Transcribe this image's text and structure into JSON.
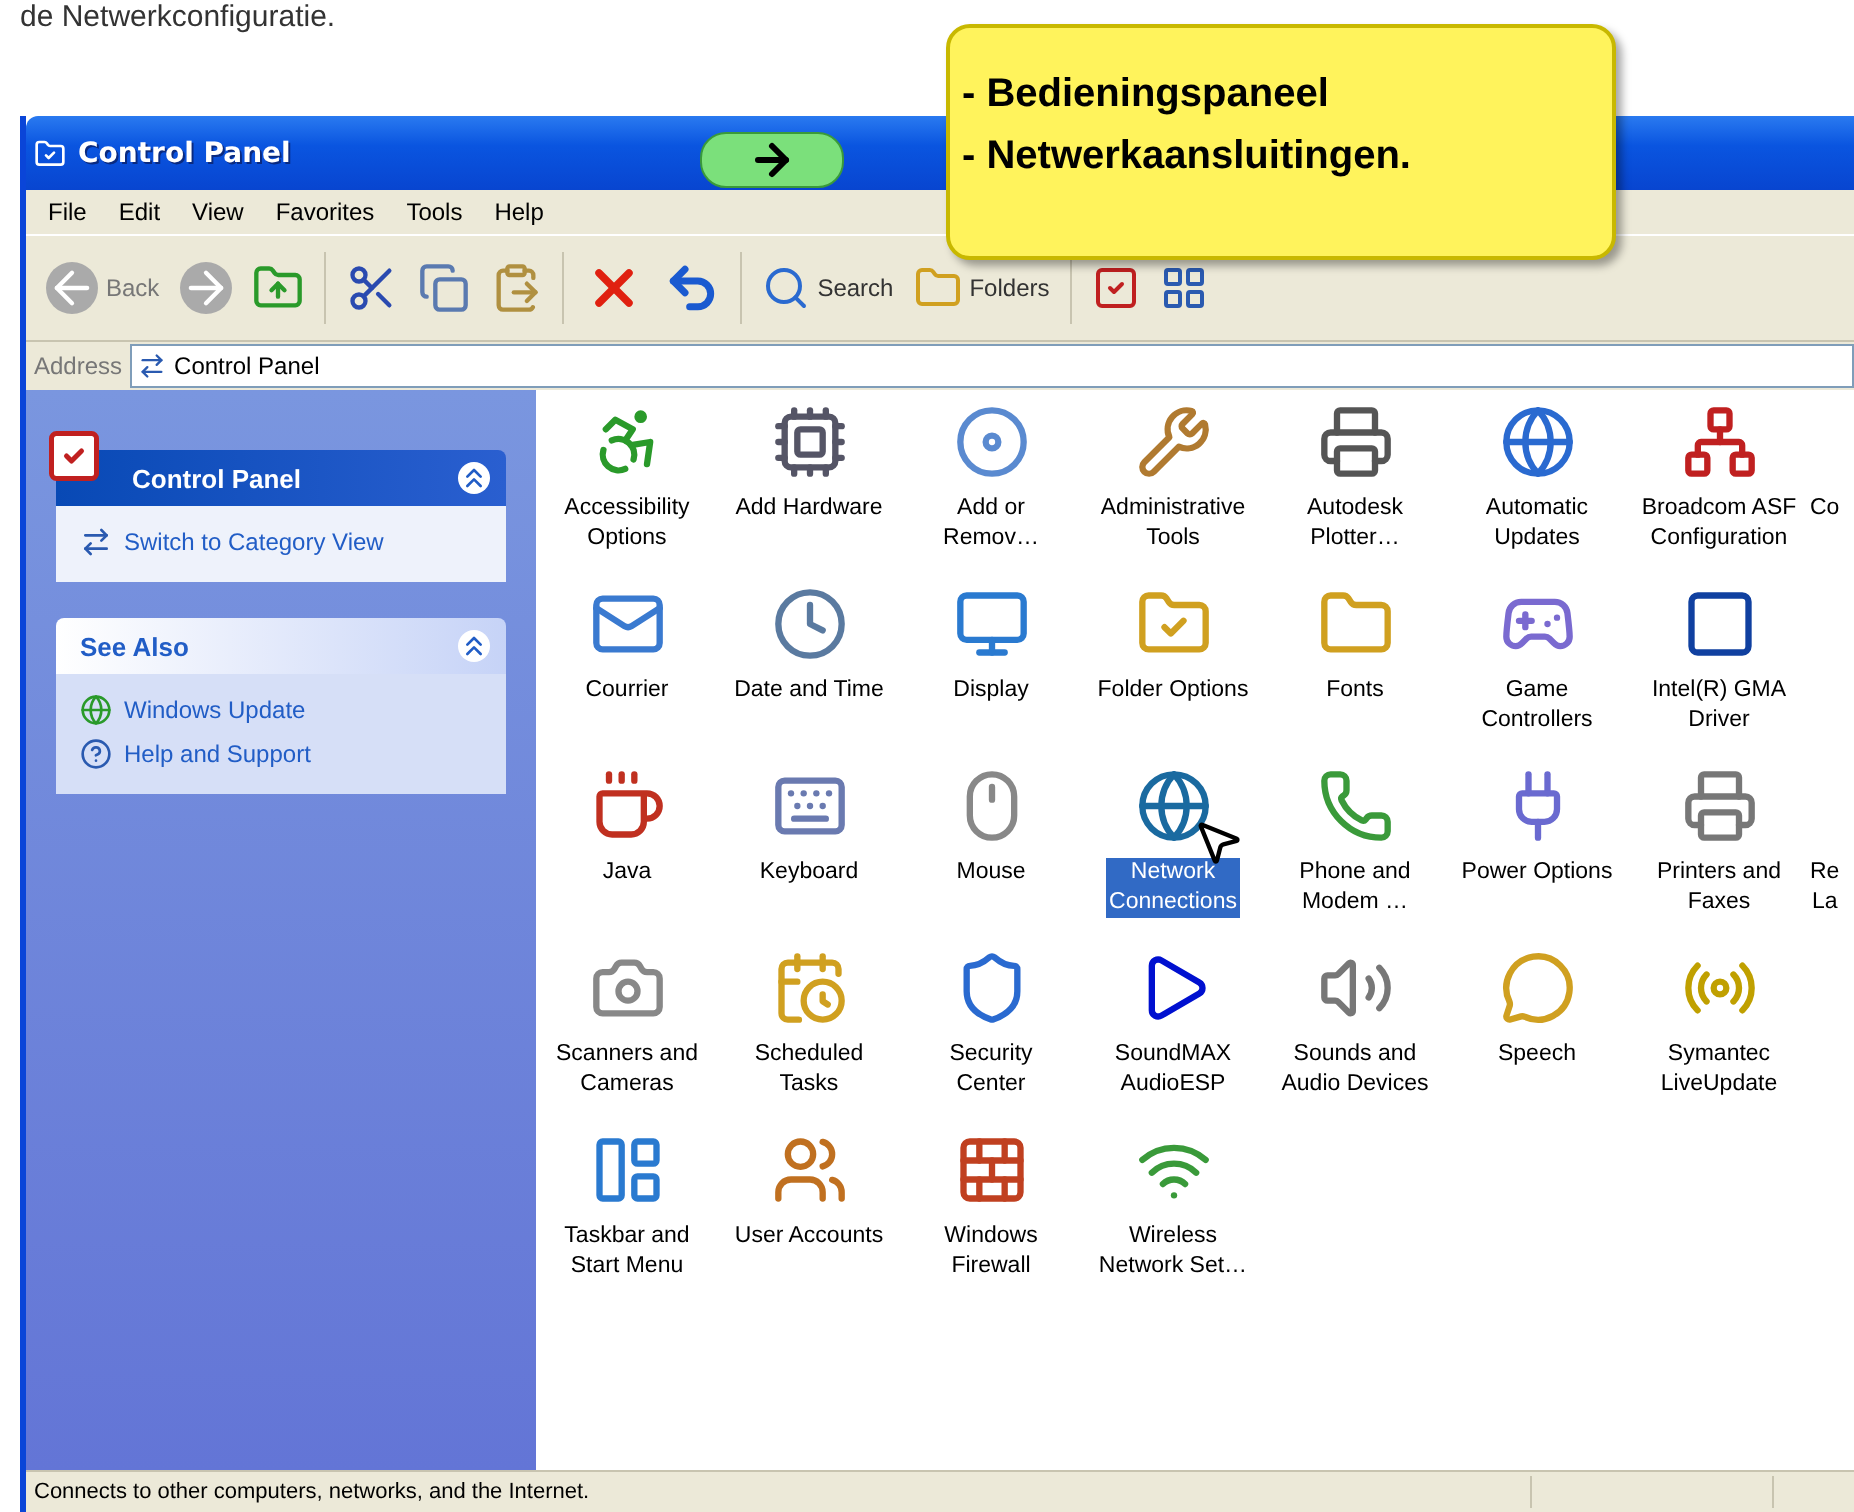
{
  "intro_text": "de Netwerkconfiguratie.",
  "callout": {
    "lines": [
      "- Bedieningspaneel",
      "- Netwerkaansluitingen."
    ]
  },
  "window": {
    "title": "Control Panel"
  },
  "menu": [
    "File",
    "Edit",
    "View",
    "Favorites",
    "Tools",
    "Help"
  ],
  "toolbar": {
    "back": "Back",
    "search": "Search",
    "folders": "Folders"
  },
  "address": {
    "label": "Address",
    "value": "Control Panel"
  },
  "sidebar": {
    "panels": [
      {
        "title": "Control Panel",
        "kind": "primary",
        "links": [
          "Switch to Category View"
        ]
      },
      {
        "title": "See Also",
        "kind": "secondary",
        "links": [
          "Windows Update",
          "Help and Support"
        ]
      }
    ]
  },
  "rows": [
    [
      {
        "lines": [
          "Accessibility",
          "Options"
        ],
        "selected": false
      },
      {
        "lines": [
          "Add Hardware"
        ],
        "selected": false
      },
      {
        "lines": [
          "Add or",
          "Remov…"
        ],
        "selected": false
      },
      {
        "lines": [
          "Administrative",
          "Tools"
        ],
        "selected": false
      },
      {
        "lines": [
          "Autodesk",
          "Plotter…"
        ],
        "selected": false
      },
      {
        "lines": [
          "Automatic",
          "Updates"
        ],
        "selected": false
      },
      {
        "lines": [
          "Broadcom ASF",
          "Configuration"
        ],
        "selected": false
      },
      {
        "lines": [
          "Co"
        ],
        "selected": false
      }
    ],
    [
      {
        "lines": [
          "Courrier"
        ],
        "selected": false
      },
      {
        "lines": [
          "Date and Time"
        ],
        "selected": false
      },
      {
        "lines": [
          "Display"
        ],
        "selected": false
      },
      {
        "lines": [
          "Folder Options"
        ],
        "selected": false
      },
      {
        "lines": [
          "Fonts"
        ],
        "selected": false
      },
      {
        "lines": [
          "Game",
          "Controllers"
        ],
        "selected": false
      },
      {
        "lines": [
          "Intel(R) GMA",
          "Driver"
        ],
        "selected": false
      }
    ],
    [
      {
        "lines": [
          "Java"
        ],
        "selected": false
      },
      {
        "lines": [
          "Keyboard"
        ],
        "selected": false
      },
      {
        "lines": [
          "Mouse"
        ],
        "selected": false
      },
      {
        "lines": [
          "Network",
          "Connections"
        ],
        "selected": true
      },
      {
        "lines": [
          "Phone and",
          "Modem …"
        ],
        "selected": false
      },
      {
        "lines": [
          "Power Options"
        ],
        "selected": false
      },
      {
        "lines": [
          "Printers and",
          "Faxes"
        ],
        "selected": false
      },
      {
        "lines": [
          "Re",
          "La"
        ],
        "selected": false
      }
    ],
    [
      {
        "lines": [
          "Scanners and",
          "Cameras"
        ],
        "selected": false
      },
      {
        "lines": [
          "Scheduled",
          "Tasks"
        ],
        "selected": false
      },
      {
        "lines": [
          "Security",
          "Center"
        ],
        "selected": false
      },
      {
        "lines": [
          "SoundMAX",
          "AudioESP"
        ],
        "selected": false
      },
      {
        "lines": [
          "Sounds and",
          "Audio Devices"
        ],
        "selected": false
      },
      {
        "lines": [
          "Speech"
        ],
        "selected": false
      },
      {
        "lines": [
          "Symantec",
          "LiveUpdate"
        ],
        "selected": false
      }
    ],
    [
      {
        "lines": [
          "Taskbar and",
          "Start Menu"
        ],
        "selected": false
      },
      {
        "lines": [
          "User Accounts"
        ],
        "selected": false
      },
      {
        "lines": [
          "Windows",
          "Firewall"
        ],
        "selected": false
      },
      {
        "lines": [
          "Wireless",
          "Network Set…"
        ],
        "selected": false
      }
    ]
  ],
  "status_bar": {
    "text": "Connects to other computers, networks, and the Internet."
  }
}
